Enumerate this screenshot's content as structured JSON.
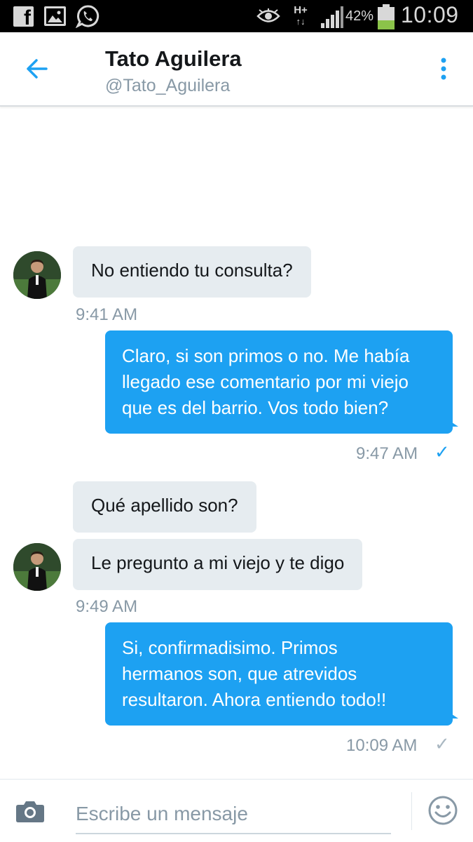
{
  "status_bar": {
    "icons": [
      "facebook-icon",
      "gallery-icon",
      "whatsapp-icon",
      "eye-icon",
      "data-hplus-icon",
      "signal-icon",
      "battery-icon"
    ],
    "network": "H+",
    "battery_percent": "42%",
    "battery_level": 0.42,
    "time": "10:09"
  },
  "header": {
    "name": "Tato Aguilera",
    "handle": "@Tato_Aguilera",
    "back_icon": "arrow-left-icon",
    "menu_icon": "more-vertical-icon",
    "accent": "#1da1f2"
  },
  "messages": [
    {
      "direction": "in",
      "text": "No entiendo tu consulta?"
    },
    {
      "direction": "in_time",
      "time": "9:41 AM"
    },
    {
      "direction": "out",
      "lines": [
        "Claro, si son primos o no. Me había",
        "llegado ese comentario por mi viejo",
        "que  es del barrio. Vos todo bien?"
      ],
      "time": "9:47 AM",
      "status": "read"
    },
    {
      "direction": "in",
      "text": "Qué apellido son?"
    },
    {
      "direction": "in",
      "text": "Le pregunto a mi viejo y te digo",
      "time": "9:49 AM"
    },
    {
      "direction": "out",
      "lines": [
        "Si, confirmadisimo. Primos",
        "hermanos son, que atrevidos",
        "resultaron. Ahora entiendo todo!!"
      ],
      "time": "10:09 AM",
      "status": "sent"
    }
  ],
  "composer": {
    "placeholder": "Escribe un mensaje",
    "camera_icon": "camera-icon",
    "emoji_icon": "emoji-icon"
  },
  "colors": {
    "outgoing_bubble": "#1da1f2",
    "incoming_bubble": "#e6ecf0",
    "timestamp": "#8899a6",
    "read_check": "#1da1f2",
    "sent_check": "#aab8c2"
  }
}
